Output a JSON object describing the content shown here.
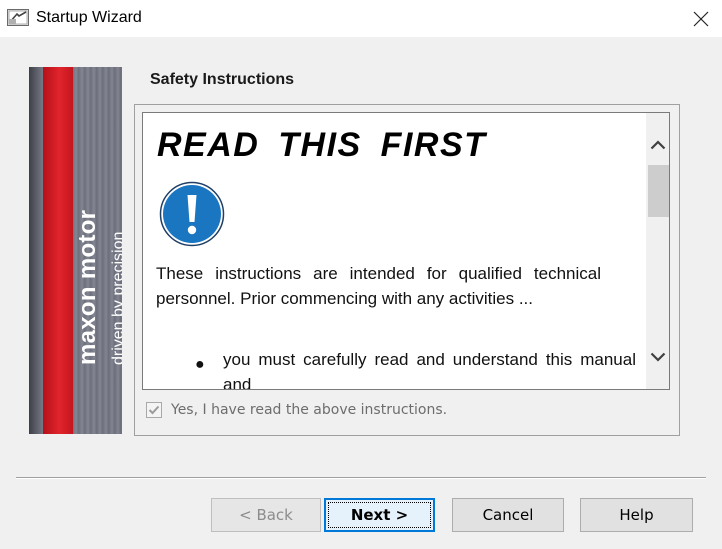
{
  "window": {
    "title": "Startup Wizard",
    "app_icon": "wizard-app-icon",
    "close_icon": "close-icon"
  },
  "banner": {
    "brand_name": "maxon motor",
    "tagline": "driven by precision",
    "colors": {
      "red": "#d91e27",
      "gray": "#6e717d"
    }
  },
  "page": {
    "heading": "Safety Instructions"
  },
  "document": {
    "title": "READ  THIS  FIRST",
    "icon": "exclamation-icon",
    "icon_color": "#1b76c2",
    "paragraph": "These instructions are intended for qualified technical personnel. Prior commencing with any activities ...",
    "bullet": "you must carefully read and understand this manual and"
  },
  "acknowledge": {
    "label": "Yes, I have read the above instructions.",
    "checked": true,
    "enabled": false
  },
  "buttons": {
    "back": "< Back",
    "next": "Next >",
    "cancel": "Cancel",
    "help": "Help"
  }
}
